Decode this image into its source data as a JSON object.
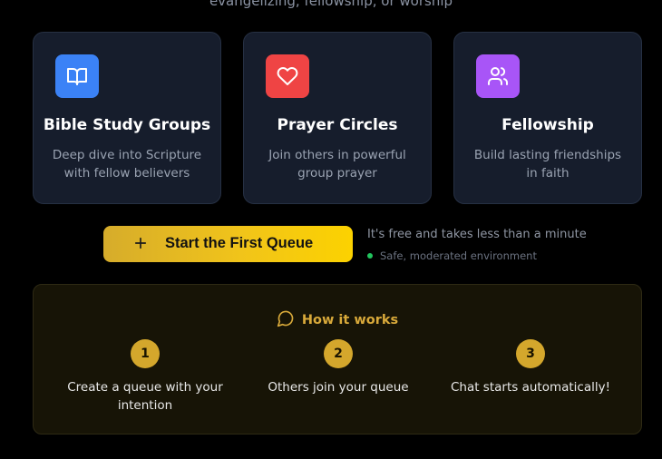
{
  "header": {
    "subtitle_fragment": "evangelizing, fellowship, or worship"
  },
  "cards": [
    {
      "title": "Bible Study Groups",
      "description": "Deep dive into Scripture with fellow believers",
      "icon": "book-icon",
      "color": "#3b82f6"
    },
    {
      "title": "Prayer Circles",
      "description": "Join others in powerful group prayer",
      "icon": "heart-icon",
      "color": "#ef4444"
    },
    {
      "title": "Fellowship",
      "description": "Build lasting friendships in faith",
      "icon": "users-icon",
      "color": "#a855f7"
    }
  ],
  "cta": {
    "label": "Start the First Queue",
    "icon": "plus-icon",
    "note": "It's free and takes less than a minute",
    "safe_text": "Safe, moderated environment",
    "safe_color": "#22c55e"
  },
  "how_it_works": {
    "title": "How it works",
    "icon": "message-circle-icon",
    "accent": "#d4a72c",
    "steps": [
      {
        "number": "1",
        "text": "Create a queue with your intention"
      },
      {
        "number": "2",
        "text": "Others join your queue"
      },
      {
        "number": "3",
        "text": "Chat starts automatically!"
      }
    ]
  }
}
